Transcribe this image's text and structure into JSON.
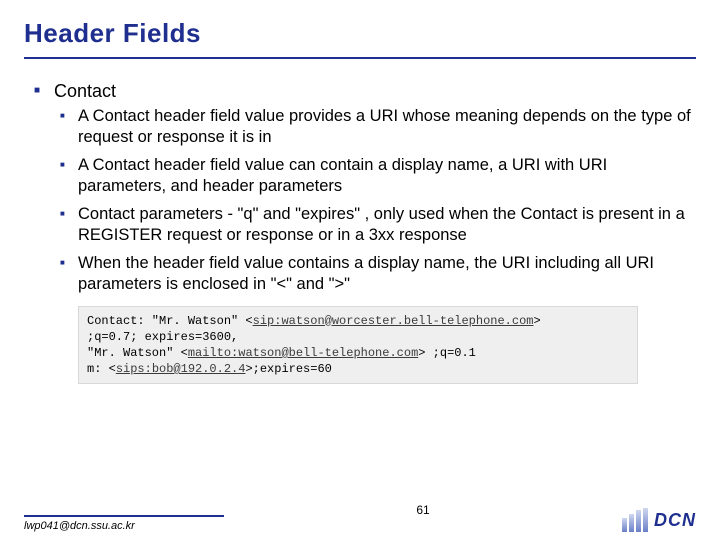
{
  "title": "Header Fields",
  "bullets": {
    "l1": "Contact",
    "l2": [
      "A Contact header field value provides a URI whose meaning depends on the type of request or response it is in",
      "A Contact header field value can contain a display name, a URI with URI parameters, and header parameters",
      "Contact parameters - \"q\" and \"expires\" , only used when the Contact is present in a REGISTER request or response or in a 3xx response",
      "When the header field value contains a display name, the URI including all URI parameters is enclosed in \"<\" and \">\""
    ]
  },
  "code": {
    "pre1": "Contact: \"Mr. Watson\" <",
    "u1": "sip:watson@worcester.bell-telephone.com",
    "post1": ">",
    "line2a": "   ;q=0.7; expires=3600,",
    "pre2": "   \"Mr. Watson\" <",
    "u2": "mailto:watson@bell-telephone.com",
    "post2": "> ;q=0.1",
    "pre3": "m: <",
    "u3": "sips:bob@192.0.2.4",
    "post3": ">;expires=60"
  },
  "footer": {
    "email": "lwp041@dcn.ssu.ac.kr",
    "page": "61",
    "logo": "DCN"
  }
}
